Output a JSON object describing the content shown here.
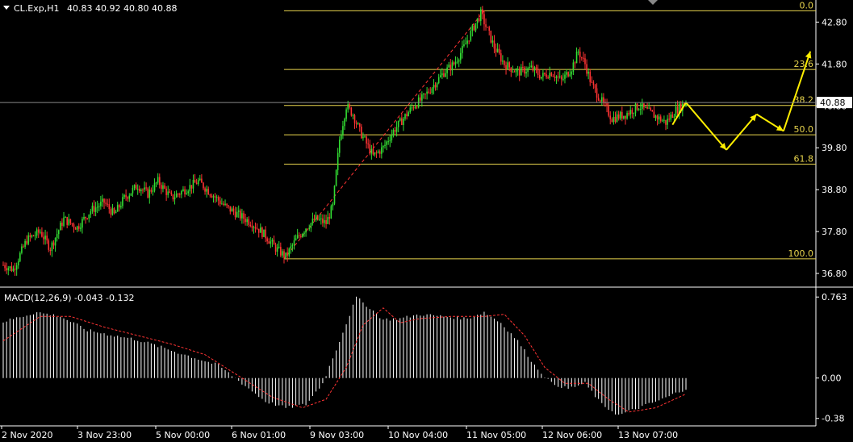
{
  "header": {
    "symbol": "CL.Exp,H1",
    "ohlc": "40.83 40.92 40.80 40.88"
  },
  "macd": {
    "label": "MACD(12,26,9) -0.043 -0.132",
    "ticks": [
      "0.763",
      "0.00",
      "-0.38"
    ]
  },
  "colors": {
    "background": "#000000",
    "bull": "#33dd33",
    "bear": "#ff3333",
    "fib": "#e8d44d",
    "arrow": "#ffee00",
    "macd_hist": "#ffffff",
    "macd_signal": "#ff3333"
  },
  "chart_data": {
    "type": "candlestick",
    "symbol": "CL.Exp",
    "timeframe": "H1",
    "current_price": "40.88",
    "y_ticks": [
      "42.80",
      "41.80",
      "40.80",
      "39.80",
      "38.80",
      "37.80",
      "36.80"
    ],
    "ylim": [
      36.55,
      43.25
    ],
    "x_labels": [
      "2 Nov 2020",
      "3 Nov 23:00",
      "5 Nov 00:00",
      "6 Nov 01:00",
      "9 Nov 03:00",
      "10 Nov 04:00",
      "11 Nov 05:00",
      "12 Nov 06:00",
      "13 Nov 07:00"
    ],
    "fibonacci": {
      "high": 43.07,
      "low": 37.15,
      "levels": [
        {
          "label": "0.0",
          "price": 43.07
        },
        {
          "label": "23.6",
          "price": 41.67
        },
        {
          "label": "38.2",
          "price": 40.81
        },
        {
          "label": "50.0",
          "price": 40.11
        },
        {
          "label": "61.8",
          "price": 39.41
        },
        {
          "label": "100.0",
          "price": 37.15
        }
      ]
    },
    "close_path": [
      [
        0,
        37.0
      ],
      [
        6,
        36.9
      ],
      [
        14,
        37.6
      ],
      [
        22,
        37.8
      ],
      [
        28,
        37.4
      ],
      [
        36,
        38.1
      ],
      [
        44,
        37.9
      ],
      [
        52,
        38.3
      ],
      [
        60,
        38.5
      ],
      [
        66,
        38.2
      ],
      [
        72,
        38.6
      ],
      [
        80,
        38.9
      ],
      [
        86,
        38.7
      ],
      [
        92,
        39.0
      ],
      [
        100,
        38.6
      ],
      [
        108,
        38.8
      ],
      [
        116,
        39.0
      ],
      [
        124,
        38.7
      ],
      [
        132,
        38.4
      ],
      [
        140,
        38.2
      ],
      [
        148,
        38.0
      ],
      [
        156,
        37.7
      ],
      [
        162,
        37.4
      ],
      [
        168,
        37.2
      ],
      [
        174,
        37.6
      ],
      [
        180,
        37.9
      ],
      [
        186,
        38.1
      ],
      [
        192,
        38.0
      ],
      [
        196,
        38.4
      ],
      [
        200,
        40.0
      ],
      [
        204,
        40.8
      ],
      [
        208,
        40.6
      ],
      [
        212,
        40.2
      ],
      [
        216,
        39.9
      ],
      [
        220,
        39.6
      ],
      [
        226,
        39.8
      ],
      [
        232,
        40.2
      ],
      [
        238,
        40.5
      ],
      [
        244,
        40.8
      ],
      [
        250,
        41.0
      ],
      [
        256,
        41.3
      ],
      [
        262,
        41.6
      ],
      [
        268,
        41.8
      ],
      [
        274,
        42.2
      ],
      [
        280,
        42.7
      ],
      [
        284,
        43.0
      ],
      [
        288,
        42.6
      ],
      [
        292,
        42.2
      ],
      [
        298,
        41.8
      ],
      [
        306,
        41.6
      ],
      [
        314,
        41.7
      ],
      [
        320,
        41.5
      ],
      [
        326,
        41.6
      ],
      [
        332,
        41.4
      ],
      [
        338,
        41.7
      ],
      [
        342,
        42.1
      ],
      [
        346,
        41.8
      ],
      [
        350,
        41.3
      ],
      [
        356,
        40.9
      ],
      [
        362,
        40.5
      ],
      [
        370,
        40.6
      ],
      [
        378,
        40.8
      ],
      [
        386,
        40.6
      ],
      [
        394,
        40.4
      ],
      [
        400,
        40.7
      ],
      [
        406,
        40.88
      ]
    ],
    "projection": [
      [
        406,
        40.88
      ],
      [
        430,
        39.75
      ],
      [
        448,
        40.6
      ],
      [
        464,
        40.2
      ],
      [
        480,
        42.1
      ]
    ],
    "macd_ylim": [
      -0.42,
      0.78
    ],
    "macd_hist_path": [
      [
        0,
        0.53
      ],
      [
        20,
        0.62
      ],
      [
        34,
        0.58
      ],
      [
        50,
        0.45
      ],
      [
        66,
        0.4
      ],
      [
        80,
        0.36
      ],
      [
        96,
        0.28
      ],
      [
        112,
        0.2
      ],
      [
        128,
        0.12
      ],
      [
        142,
        -0.05
      ],
      [
        156,
        -0.22
      ],
      [
        168,
        -0.28
      ],
      [
        180,
        -0.25
      ],
      [
        190,
        -0.05
      ],
      [
        200,
        0.35
      ],
      [
        210,
        0.76
      ],
      [
        218,
        0.66
      ],
      [
        226,
        0.55
      ],
      [
        236,
        0.56
      ],
      [
        248,
        0.6
      ],
      [
        262,
        0.58
      ],
      [
        276,
        0.56
      ],
      [
        286,
        0.62
      ],
      [
        296,
        0.52
      ],
      [
        306,
        0.35
      ],
      [
        316,
        0.12
      ],
      [
        326,
        -0.05
      ],
      [
        336,
        -0.1
      ],
      [
        346,
        -0.05
      ],
      [
        356,
        -0.25
      ],
      [
        366,
        -0.35
      ],
      [
        378,
        -0.28
      ],
      [
        392,
        -0.2
      ],
      [
        406,
        -0.1
      ]
    ],
    "macd_signal_path": [
      [
        0,
        0.35
      ],
      [
        22,
        0.58
      ],
      [
        40,
        0.58
      ],
      [
        60,
        0.48
      ],
      [
        80,
        0.4
      ],
      [
        100,
        0.32
      ],
      [
        120,
        0.22
      ],
      [
        140,
        0.02
      ],
      [
        160,
        -0.18
      ],
      [
        178,
        -0.28
      ],
      [
        192,
        -0.2
      ],
      [
        204,
        0.1
      ],
      [
        214,
        0.5
      ],
      [
        226,
        0.66
      ],
      [
        236,
        0.52
      ],
      [
        248,
        0.56
      ],
      [
        266,
        0.58
      ],
      [
        286,
        0.58
      ],
      [
        298,
        0.6
      ],
      [
        310,
        0.4
      ],
      [
        322,
        0.1
      ],
      [
        334,
        -0.05
      ],
      [
        348,
        -0.05
      ],
      [
        360,
        -0.2
      ],
      [
        372,
        -0.32
      ],
      [
        388,
        -0.28
      ],
      [
        406,
        -0.15
      ]
    ]
  }
}
